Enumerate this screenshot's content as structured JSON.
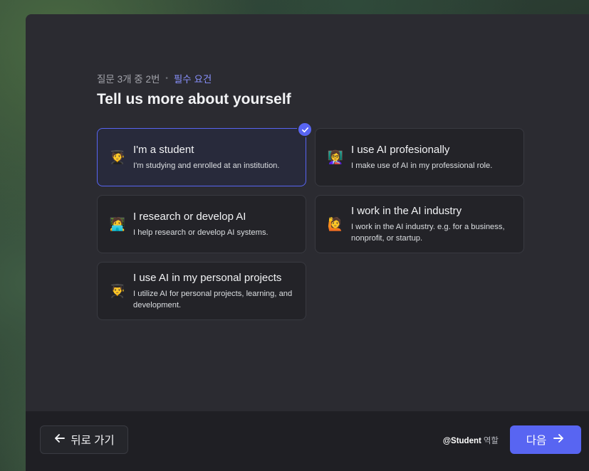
{
  "header": {
    "step_text": "질문 3개 중 2번",
    "separator": "•",
    "required_text": "필수 요건",
    "title": "Tell us more about yourself"
  },
  "options": [
    {
      "emoji": "🧑‍🎓",
      "title": "I'm a student",
      "desc": "I'm studying and enrolled at an institution.",
      "selected": true
    },
    {
      "emoji": "👩‍🏫",
      "title": "I use AI profesionally",
      "desc": "I make use of AI in my professional role.",
      "selected": false
    },
    {
      "emoji": "🧑‍💻",
      "title": "I research or develop AI",
      "desc": "I help research or develop AI systems.",
      "selected": false
    },
    {
      "emoji": "🙋",
      "title": "I work in the AI industry",
      "desc": "I work in the AI industry. e.g. for a business, nonprofit, or startup.",
      "selected": false
    },
    {
      "emoji": "👨‍🎓",
      "title": "I use AI in my personal projects",
      "desc": "I utilize AI for personal projects, learning, and development.",
      "selected": false
    }
  ],
  "footer": {
    "back_label": "뒤로 가기",
    "role_name": "@Student",
    "role_suffix": "역할",
    "next_label": "다음"
  },
  "colors": {
    "accent": "#5865f2",
    "required": "#8a92ff",
    "card_bg": "#232328",
    "modal_bg": "#2b2b31"
  }
}
